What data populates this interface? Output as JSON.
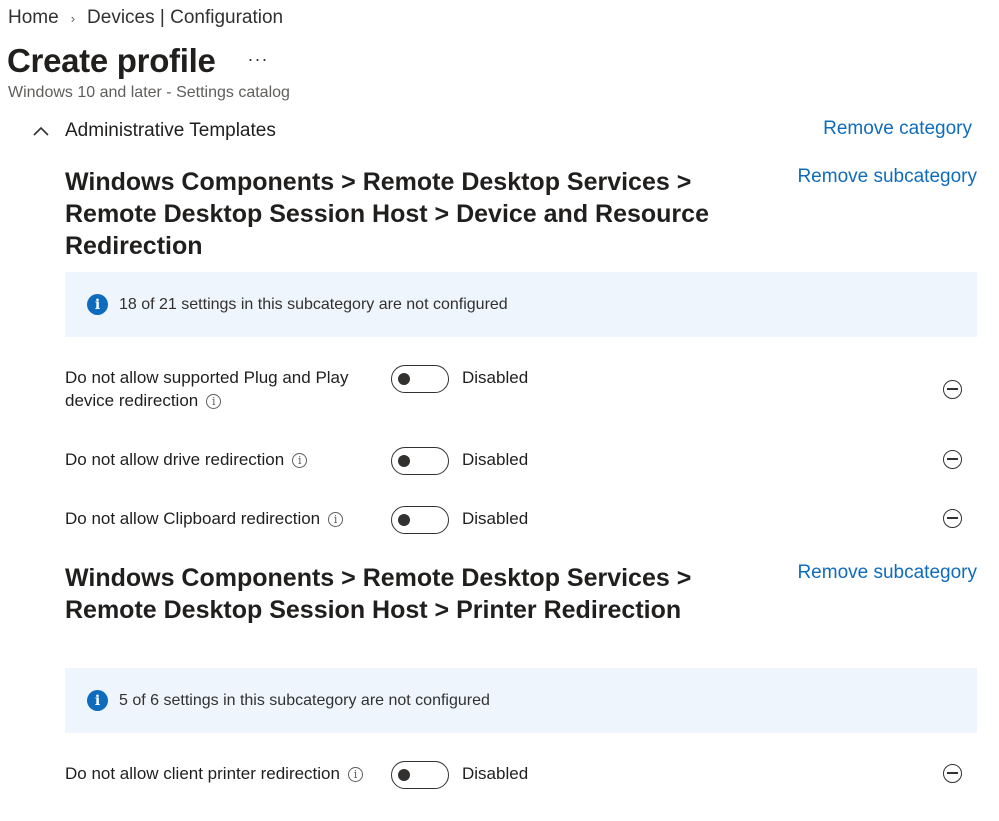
{
  "breadcrumb": {
    "home": "Home",
    "separator": "›",
    "current": "Devices | Configuration"
  },
  "header": {
    "title": "Create profile",
    "more": "···",
    "subtitle": "Windows 10 and later - Settings catalog"
  },
  "category": {
    "label": "Administrative Templates",
    "remove_label": "Remove category",
    "expanded": true
  },
  "subcategories": [
    {
      "title": "Windows Components > Remote Desktop Services > Remote Desktop Session Host > Device and Resource Redirection",
      "remove_label": "Remove subcategory",
      "info": "18 of 21 settings in this subcategory are not configured",
      "settings": [
        {
          "label": "Do not allow supported Plug and Play device redirection",
          "state": "Disabled"
        },
        {
          "label": "Do not allow drive redirection",
          "state": "Disabled"
        },
        {
          "label": "Do not allow Clipboard redirection",
          "state": "Disabled"
        }
      ]
    },
    {
      "title": "Windows Components > Remote Desktop Services > Remote Desktop Session Host > Printer Redirection",
      "remove_label": "Remove subcategory",
      "info": "5 of 6 settings in this subcategory are not configured",
      "settings": [
        {
          "label": "Do not allow client printer redirection",
          "state": "Disabled"
        }
      ]
    }
  ],
  "icons": {
    "info": "i",
    "tooltip": "i"
  },
  "colors": {
    "link": "#0f6cbd",
    "info_bar_bg": "#eff5fd",
    "info_icon": "#0f6cbd"
  }
}
